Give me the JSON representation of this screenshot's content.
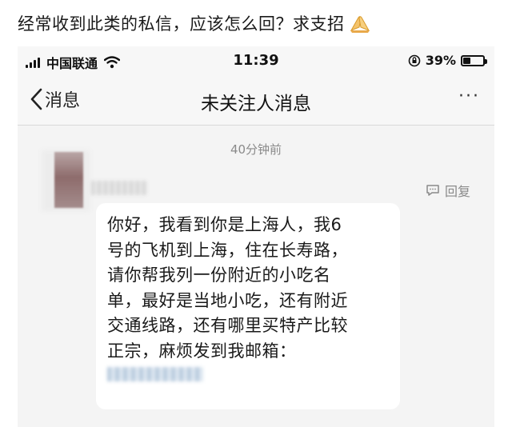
{
  "caption": {
    "text": "经常收到此类的私信，应该怎么回？求支招",
    "emoji_icon": "folded-hands-icon"
  },
  "status_bar": {
    "carrier": "中国联通",
    "time": "11:39",
    "battery_percent": "39%",
    "battery_level": 0.39,
    "icons": [
      "signal-icon",
      "wifi-icon",
      "orientation-lock-icon",
      "battery-icon"
    ]
  },
  "nav": {
    "back_label": "消息",
    "title": "未关注人消息",
    "more_label": "···"
  },
  "thread": {
    "timestamp": "40分钟前",
    "reply_label": "回复",
    "message_lines": [
      "你好，我看到你是上海人，我6",
      "号的飞机到上海，住在长寿路，",
      "请你帮我列一份附近的小吃名",
      "单，最好是当地小吃，还有附近",
      "交通线路，还有哪里买特产比较",
      "正宗，麻烦发到我邮箱："
    ]
  },
  "colors": {
    "accent_text": "#111111",
    "muted_text": "#8a8a8a",
    "bubble_bg": "#ffffff",
    "screen_bg": "#f4f4f4"
  }
}
